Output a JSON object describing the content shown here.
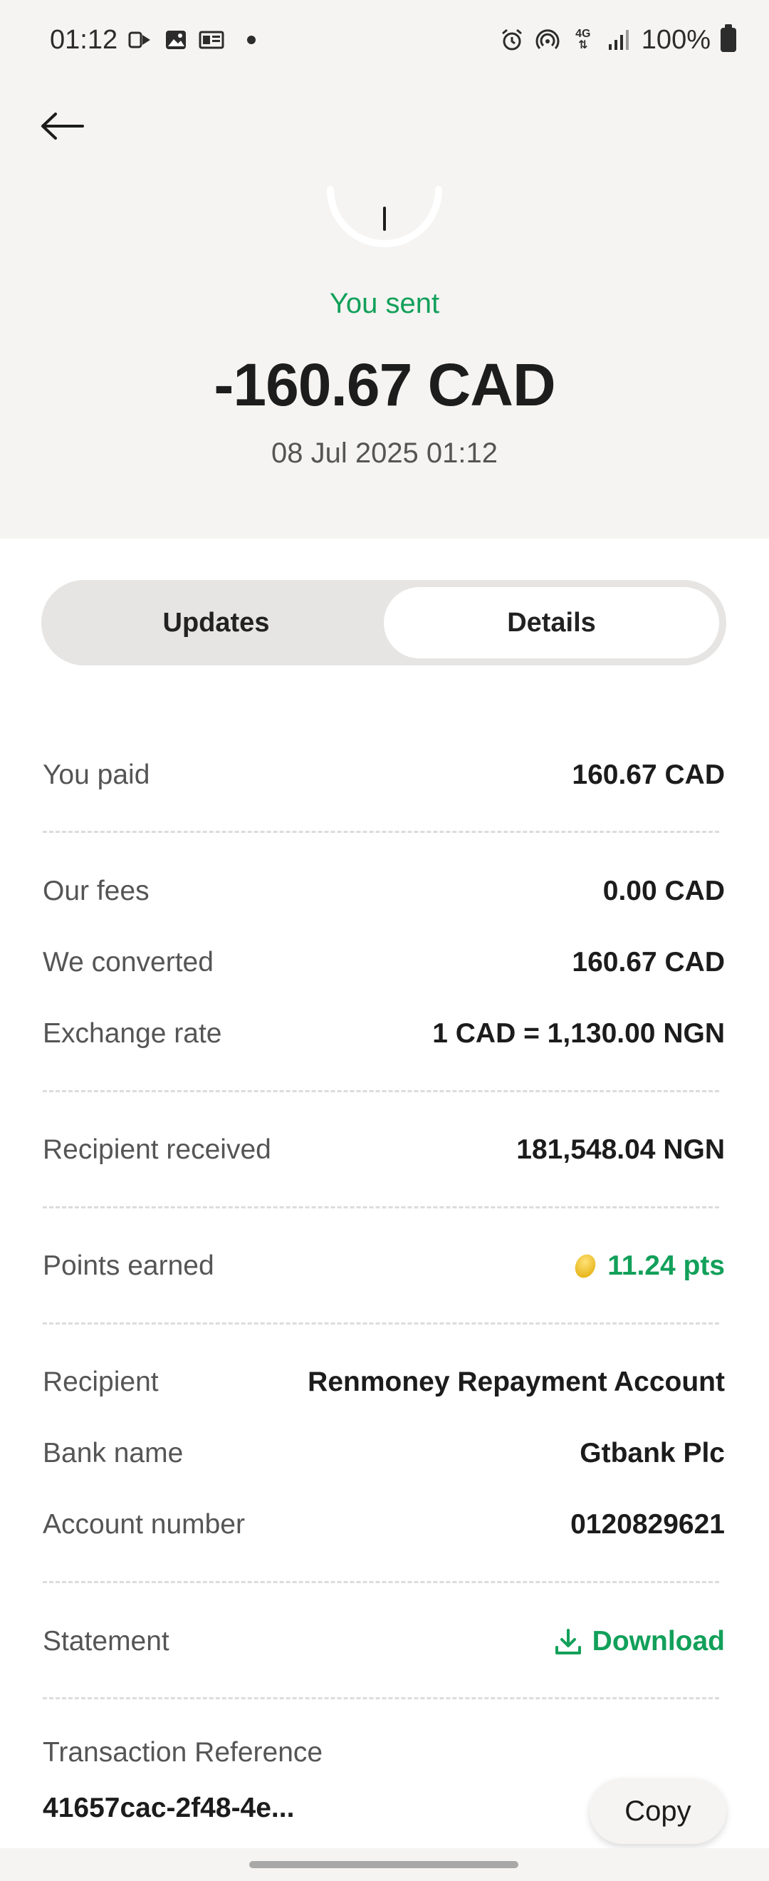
{
  "status_bar": {
    "time": "01:12",
    "battery": "100%",
    "network": "4G"
  },
  "header": {
    "sent_label": "You sent",
    "amount": "-160.67 CAD",
    "date": "08 Jul 2025 01:12"
  },
  "tabs": [
    {
      "label": "Updates",
      "active": false
    },
    {
      "label": "Details",
      "active": true
    }
  ],
  "details": {
    "you_paid": {
      "label": "You paid",
      "value": "160.67 CAD"
    },
    "our_fees": {
      "label": "Our fees",
      "value": "0.00 CAD"
    },
    "we_converted": {
      "label": "We converted",
      "value": "160.67 CAD"
    },
    "exchange_rate": {
      "label": "Exchange rate",
      "value": "1 CAD = 1,130.00 NGN"
    },
    "recipient_received": {
      "label": "Recipient received",
      "value": "181,548.04 NGN"
    },
    "points_earned": {
      "label": "Points earned",
      "value": "11.24 pts"
    },
    "recipient": {
      "label": "Recipient",
      "value": "Renmoney Repayment Account"
    },
    "bank_name": {
      "label": "Bank name",
      "value": "Gtbank Plc"
    },
    "account_number": {
      "label": "Account number",
      "value": "0120829621"
    },
    "statement": {
      "label": "Statement",
      "value": "Download"
    },
    "transaction_reference": {
      "label": "Transaction Reference",
      "value": "41657cac-2f48-4e..."
    }
  },
  "copy_button": "Copy",
  "colors": {
    "accent_green": "#12a05a",
    "background": "#f5f4f2",
    "card": "#ffffff"
  }
}
